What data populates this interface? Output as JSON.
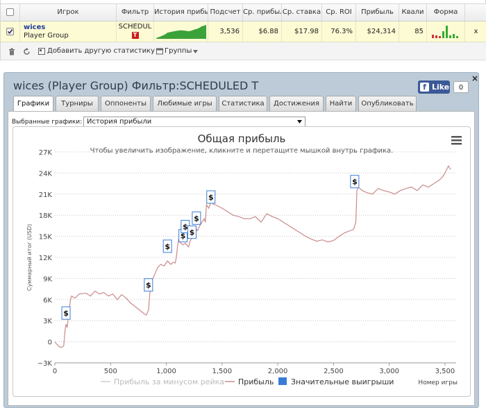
{
  "table": {
    "headers": {
      "player": "Игрок",
      "filter": "Фильтр",
      "history": "История прибыл",
      "count": "Подсчет",
      "avg_profit": "Ср. прибыл",
      "avg_stake": "Ср. ставка",
      "avg_roi": "Ср. ROI",
      "profit": "Прибыль",
      "qual": "Квали",
      "form": "Форма"
    },
    "row": {
      "player_name": "wices",
      "player_group": "Player Group",
      "filter": "SCHEDUL",
      "count": "3,536",
      "avg_profit": "$6.88",
      "avg_stake": "$17.98",
      "avg_roi": "76.3%",
      "profit": "$24,314",
      "qual": "85",
      "remove": "x"
    },
    "history_sparkline": [
      0.05,
      0.12,
      0.18,
      0.25,
      0.33,
      0.45,
      0.48,
      0.52,
      0.55,
      0.58,
      0.6,
      0.62,
      0.6,
      0.58,
      0.55,
      0.57,
      0.62,
      0.68,
      0.72,
      0.8,
      0.9,
      0.95,
      1.0
    ],
    "form_bars": [
      {
        "value": 0.25,
        "color": "#cc3333"
      },
      {
        "value": 0.2,
        "color": "#cc3333"
      },
      {
        "value": 0.15,
        "color": "#cc3333"
      },
      {
        "value": 0.5,
        "color": "#33aa33"
      },
      {
        "value": 0.9,
        "color": "#33aa33"
      },
      {
        "value": 0.2,
        "color": "#33aa33"
      },
      {
        "value": 0.3,
        "color": "#33aa33"
      },
      {
        "value": 0.15,
        "color": "#33aa33"
      }
    ],
    "toolbar": {
      "add_stats": "Добавить другую статистику",
      "groups": "Группы"
    }
  },
  "window": {
    "title": "wices (Player Group) Фильтр:SCHEDULED T",
    "facebook_like": "Like",
    "facebook_count": "0",
    "close": "×",
    "tabs": [
      "Графики",
      "Турниры",
      "Оппоненты",
      "Любимые игры",
      "Статистика",
      "Достижения",
      "Найти",
      "Опубликовать"
    ],
    "active_tab": 0,
    "selected_charts_label": "Выбранные графики:",
    "selected_chart": "История прибыли"
  },
  "chart_data": {
    "type": "line",
    "title": "Общая прибыль",
    "subtitle": "Чтобы увеличить изображение, кликните и перетащите мышкой внутрь графика.",
    "ylabel": "Суммарный итог (USD)",
    "xlabel": "Номер игры",
    "xlim": [
      0,
      3600
    ],
    "ylim": [
      -3000,
      27000
    ],
    "x_ticks": [
      0,
      500,
      1000,
      1500,
      2000,
      2500,
      3000,
      3500
    ],
    "x_tick_labels": [
      "0",
      "500",
      "1,000",
      "1,500",
      "2,000",
      "2,500",
      "3,000",
      "3,500"
    ],
    "y_ticks": [
      -3000,
      0,
      3000,
      6000,
      9000,
      12000,
      15000,
      18000,
      21000,
      24000,
      27000
    ],
    "y_tick_labels": [
      "−3K",
      "0",
      "3K",
      "6K",
      "9K",
      "12K",
      "15K",
      "18K",
      "21K",
      "24K",
      "27K"
    ],
    "grid": true,
    "legend_position": "bottom",
    "series": [
      {
        "name": "Прибыль",
        "color": "#c98a8a",
        "x": [
          0,
          20,
          40,
          60,
          80,
          90,
          100,
          110,
          140,
          150,
          180,
          220,
          280,
          320,
          360,
          400,
          440,
          480,
          520,
          560,
          600,
          640,
          680,
          720,
          760,
          800,
          820,
          840,
          850,
          860,
          870,
          880,
          920,
          950,
          980,
          1010,
          1040,
          1060,
          1080,
          1090,
          1100,
          1110,
          1130,
          1150,
          1170,
          1200,
          1210,
          1230,
          1250,
          1260,
          1270,
          1280,
          1300,
          1320,
          1340,
          1350,
          1360,
          1380,
          1400,
          1420,
          1450,
          1500,
          1550,
          1600,
          1650,
          1700,
          1750,
          1800,
          1850,
          1900,
          1950,
          2000,
          2050,
          2100,
          2150,
          2200,
          2250,
          2300,
          2350,
          2400,
          2450,
          2500,
          2550,
          2600,
          2650,
          2680,
          2700,
          2710,
          2720,
          2760,
          2800,
          2850,
          2900,
          2950,
          3000,
          3050,
          3100,
          3150,
          3200,
          3250,
          3300,
          3350,
          3400,
          3450,
          3480,
          3500,
          3530,
          3550
        ],
        "values": [
          0,
          -400,
          -700,
          -800,
          -600,
          1500,
          2500,
          2000,
          6000,
          6500,
          6200,
          6800,
          6900,
          6500,
          7200,
          6800,
          7000,
          6500,
          6800,
          6000,
          6700,
          6200,
          5500,
          5000,
          4500,
          4000,
          3800,
          4500,
          6500,
          8000,
          8500,
          9000,
          10500,
          11000,
          10800,
          11500,
          11000,
          11300,
          11200,
          12000,
          13500,
          14500,
          14000,
          13800,
          14000,
          13500,
          14200,
          14800,
          15500,
          15000,
          16000,
          15800,
          16500,
          17000,
          17500,
          17000,
          19500,
          19000,
          19800,
          19600,
          19400,
          19000,
          18500,
          18000,
          17800,
          17500,
          17500,
          17800,
          17000,
          18200,
          17800,
          17500,
          17000,
          16500,
          16000,
          15500,
          15000,
          14600,
          14300,
          14500,
          14200,
          14400,
          15000,
          15500,
          15800,
          16000,
          17000,
          21500,
          22000,
          21500,
          21200,
          21000,
          21800,
          21500,
          21300,
          21000,
          21500,
          21800,
          22000,
          21500,
          22300,
          22000,
          22500,
          23000,
          23500,
          24000,
          25000,
          24500
        ]
      },
      {
        "name": "Прибыль за минусом рейка",
        "color": "#cccccc",
        "x": [],
        "values": []
      }
    ],
    "significant_wins": {
      "name": "Значительные выигрыши",
      "color": "#3a7bd5",
      "marker": "$",
      "points": [
        {
          "x": 100,
          "y": 3000
        },
        {
          "x": 840,
          "y": 7000
        },
        {
          "x": 1010,
          "y": 12500
        },
        {
          "x": 1150,
          "y": 14000
        },
        {
          "x": 1170,
          "y": 15300
        },
        {
          "x": 1230,
          "y": 14500
        },
        {
          "x": 1270,
          "y": 16500
        },
        {
          "x": 1400,
          "y": 19500
        },
        {
          "x": 2690,
          "y": 21700
        }
      ]
    }
  }
}
